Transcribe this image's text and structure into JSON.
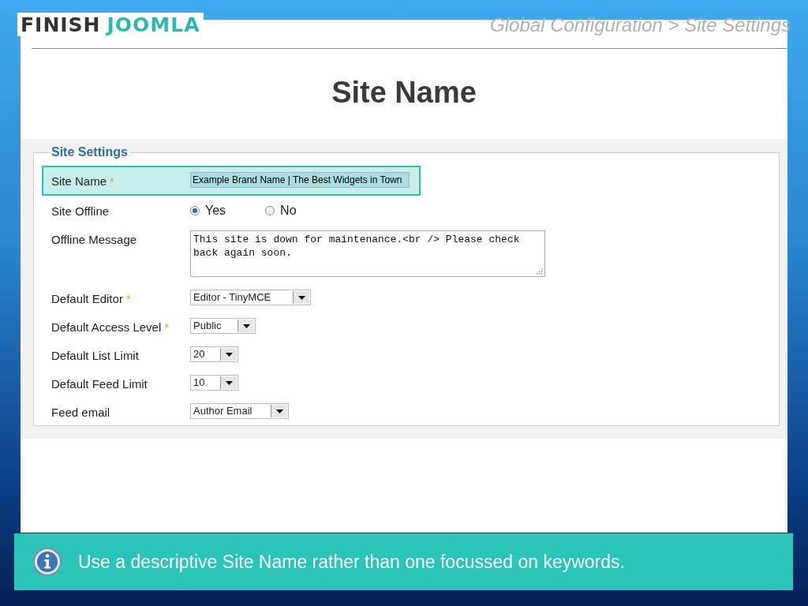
{
  "logo": {
    "part_1": "FINISH",
    "part_2": "JOOMLA"
  },
  "breadcrumb": "Global Configuration > Site Settings",
  "title": "Site Name",
  "fieldset": {
    "legend": "Site Settings",
    "fields": [
      {
        "kind": "text",
        "label": "Site Name",
        "required_mark": "*",
        "highlighted": true,
        "value": "Example Brand Name | The Best Widgets in Town"
      },
      {
        "kind": "radio",
        "label": "Site Offline",
        "highlighted": false,
        "options": [
          {
            "label": "Yes",
            "selected": true
          },
          {
            "label": "No",
            "selected": false
          }
        ]
      },
      {
        "kind": "textarea",
        "label": "Offline Message",
        "highlighted": false,
        "value": "This site is down for maintenance.<br /> Please check back again soon."
      },
      {
        "kind": "select",
        "label": "Default Editor",
        "required_mark": "*",
        "highlighted": false,
        "value": "Editor - TinyMCE"
      },
      {
        "kind": "select",
        "label": "Default Access Level",
        "required_mark": "*",
        "highlighted": false,
        "value": "Public"
      },
      {
        "kind": "select",
        "label": "Default List Limit",
        "highlighted": false,
        "value": "20"
      },
      {
        "kind": "select",
        "label": "Default Feed Limit",
        "highlighted": false,
        "value": "10"
      },
      {
        "kind": "select",
        "label": "Feed email",
        "highlighted": false,
        "value": "Author Email"
      }
    ]
  },
  "tip": "Use a descriptive Site Name rather than one focussed on keywords."
}
